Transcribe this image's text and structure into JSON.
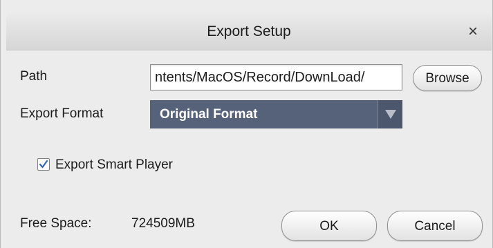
{
  "dialog": {
    "title": "Export Setup",
    "close_glyph": "×"
  },
  "path": {
    "label": "Path",
    "value": "ntents/MacOS/Record/DownLoad/",
    "browse_label": "Browse"
  },
  "export_format": {
    "label": "Export Format",
    "selected": "Original Format"
  },
  "smart_player": {
    "label": "Export Smart Player",
    "checked": true
  },
  "free_space": {
    "label": "Free Space:",
    "value": "724509MB"
  },
  "buttons": {
    "ok_label": "OK",
    "cancel_label": "Cancel"
  },
  "colors": {
    "select_background": "#56617a",
    "check_mark": "#2f66c5"
  },
  "icons": {
    "close": "close-icon",
    "dropdown": "dropdown-arrow-icon",
    "checkmark": "checkmark-icon"
  }
}
